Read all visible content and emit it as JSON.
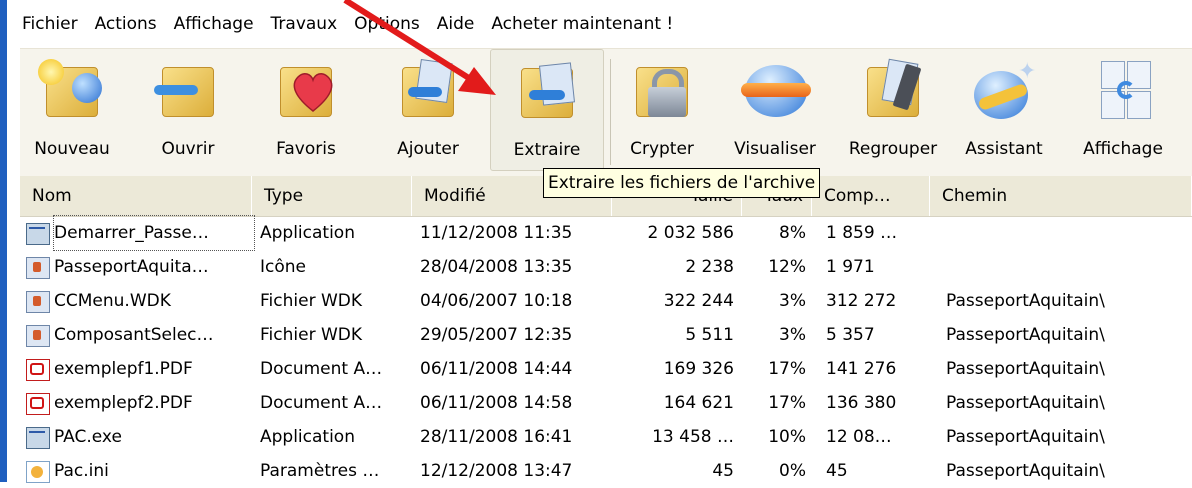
{
  "menu": [
    "Fichier",
    "Actions",
    "Affichage",
    "Travaux",
    "Options",
    "Aide",
    "Acheter maintenant !"
  ],
  "toolbar": [
    {
      "label": "Nouveau",
      "icon": "new-archive-icon"
    },
    {
      "label": "Ouvrir",
      "icon": "open-folder-icon"
    },
    {
      "label": "Favoris",
      "icon": "favorites-heart-icon"
    },
    {
      "label": "Ajouter",
      "icon": "add-files-icon"
    },
    {
      "label": "Extraire",
      "icon": "extract-files-icon"
    },
    {
      "label": "Crypter",
      "icon": "encrypt-lock-icon"
    },
    {
      "label": "Visualiser",
      "icon": "view-glasses-icon"
    },
    {
      "label": "Regrouper",
      "icon": "merge-files-icon"
    },
    {
      "label": "Assistant",
      "icon": "wizard-icon"
    },
    {
      "label": "Affichage",
      "icon": "display-icon"
    }
  ],
  "tooltip": "Extraire les fichiers de l'archive",
  "columns": {
    "nom": "Nom",
    "type": "Type",
    "modifie": "Modifié",
    "taille": "Taille",
    "taux": "Taux",
    "comp": "Comp…",
    "chemin": "Chemin"
  },
  "rows": [
    {
      "icon": "application",
      "nom": "Demarrer_Passe…",
      "type": "Application",
      "modifie": "11/12/2008 11:35",
      "taille": "2 032 586",
      "taux": "8%",
      "comp": "1 859 …",
      "chemin": ""
    },
    {
      "icon": "document",
      "nom": "PasseportAquita…",
      "type": "Icône",
      "modifie": "28/04/2008 13:35",
      "taille": "2 238",
      "taux": "12%",
      "comp": "1 971",
      "chemin": ""
    },
    {
      "icon": "document",
      "nom": "CCMenu.WDK",
      "type": "Fichier WDK",
      "modifie": "04/06/2007 10:18",
      "taille": "322 244",
      "taux": "3%",
      "comp": "312 272",
      "chemin": "PasseportAquitain\\"
    },
    {
      "icon": "document",
      "nom": "ComposantSelec…",
      "type": "Fichier WDK",
      "modifie": "29/05/2007 12:35",
      "taille": "5 511",
      "taux": "3%",
      "comp": "5 357",
      "chemin": "PasseportAquitain\\"
    },
    {
      "icon": "pdf",
      "nom": "exemplepf1.PDF",
      "type": "Document A…",
      "modifie": "06/11/2008 14:44",
      "taille": "169 326",
      "taux": "17%",
      "comp": "141 276",
      "chemin": "PasseportAquitain\\"
    },
    {
      "icon": "pdf",
      "nom": "exemplepf2.PDF",
      "type": "Document A…",
      "modifie": "06/11/2008 14:58",
      "taille": "164 621",
      "taux": "17%",
      "comp": "136 380",
      "chemin": "PasseportAquitain\\"
    },
    {
      "icon": "application",
      "nom": "PAC.exe",
      "type": "Application",
      "modifie": "28/11/2008 16:41",
      "taille": "13 458 …",
      "taux": "10%",
      "comp": "12 08…",
      "chemin": "PasseportAquitain\\"
    },
    {
      "icon": "ini",
      "nom": "Pac.ini",
      "type": "Paramètres …",
      "modifie": "12/12/2008 13:47",
      "taille": "45",
      "taux": "0%",
      "comp": "45",
      "chemin": "PasseportAquitain\\"
    }
  ],
  "colors": {
    "annotation_arrow": "#e21b1b",
    "toolbar_bg": "#f6f4ec",
    "header_bg": "#ece9d8",
    "tooltip_bg": "#ffffe1"
  }
}
